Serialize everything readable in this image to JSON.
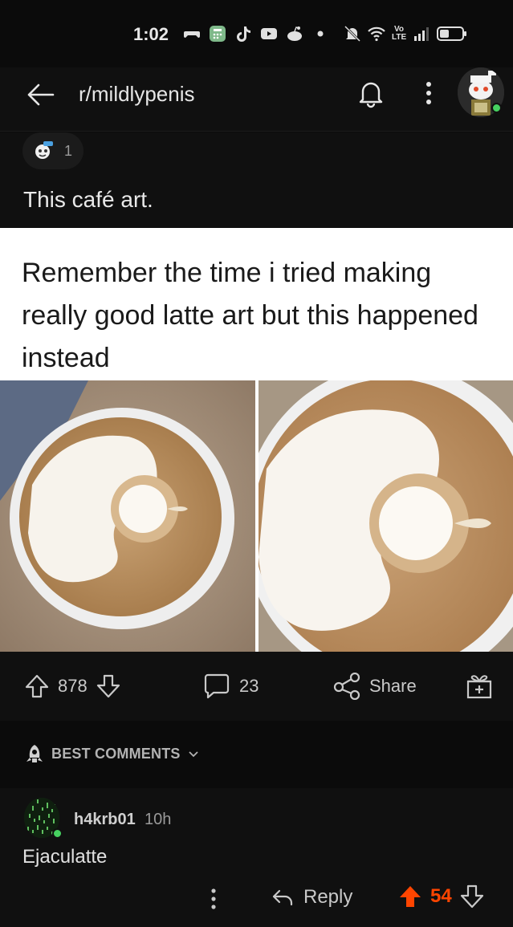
{
  "status_bar": {
    "time": "1:02",
    "icons": [
      "game-controller-icon",
      "calculator-app-icon",
      "tiktok-icon",
      "youtube-icon",
      "reddit-icon",
      "dot-icon",
      "bell-muted-icon",
      "wifi-icon",
      "volte-icon",
      "signal-icon",
      "battery-icon"
    ],
    "volte_label": "Vo LTE"
  },
  "header": {
    "subreddit": "r/mildlypenis"
  },
  "post": {
    "award_count": "1",
    "title": "This café art.",
    "image_caption": "Remember the time i tried making really good latte art but this happened instead"
  },
  "actions": {
    "upvotes": "878",
    "comments": "23",
    "share_label": "Share"
  },
  "comments_sort": {
    "label": "BEST COMMENTS"
  },
  "comment": {
    "username": "h4krb01",
    "time": "10h",
    "body": "Ejaculatte",
    "reply_label": "Reply",
    "score": "54"
  },
  "colors": {
    "background": "#101010",
    "upvote_active": "#ff4500",
    "online": "#46d160",
    "coffee": "#b08455"
  }
}
